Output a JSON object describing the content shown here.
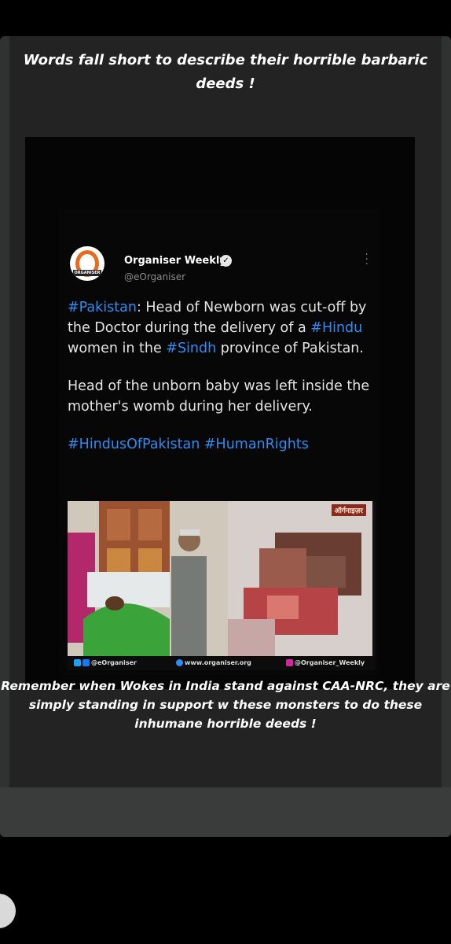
{
  "story": {
    "caption_top": "Words fall short to describe their horrible barbaric deeds !",
    "caption_bottom": "Remember when Wokes in India stand against CAA-NRC, they are simply standing in support w these monsters to do these inhumane horrible deeds !"
  },
  "tweet": {
    "author_name": "Organiser Weekly",
    "handle": "@eOrganiser",
    "verified_icon": "verified-badge-icon",
    "para1": {
      "tag1": "#Pakistan",
      "text1": ": Head of Newborn was cut-off by the Doctor during the delivery of a ",
      "tag2": "#Hindu",
      "text2": " women in the ",
      "tag3": "#Sindh",
      "text3": " province of Pakistan."
    },
    "para2": "Head of the unborn baby was left inside the mother's womb during her delivery.",
    "hashtags": "#HindusOfPakistan #HumanRights"
  },
  "image": {
    "brand_label": "ऑर्गनाइज़र",
    "footer_twitter": "@eOrganiser",
    "footer_web": "www.organiser.org",
    "footer_insta": "@Organiser_Weekly"
  },
  "colors": {
    "hashtag": "#2f8cf2",
    "logo_orange": "#e66b1d"
  }
}
